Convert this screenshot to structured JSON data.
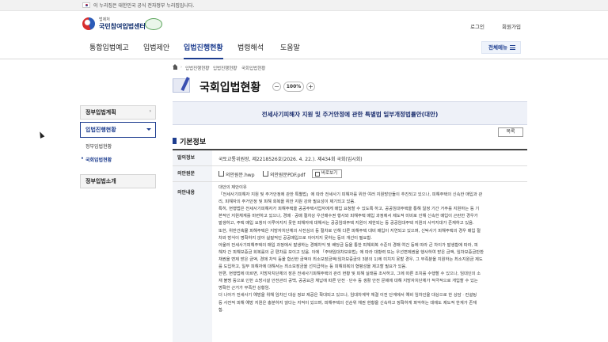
{
  "gov_banner": {
    "text": "이 누리집은 대한민국 공식 전자정부 누리집입니다."
  },
  "header": {
    "logo_small": "법제처",
    "logo_main": "국민참여입법센터",
    "util_links": [
      "로그인",
      "회원가입"
    ]
  },
  "gnb": {
    "items": [
      "통합입법예고",
      "입법제안",
      "입법진행현황",
      "법령해석",
      "도움말"
    ],
    "active": "입법진행현황",
    "all_menu": "전체메뉴"
  },
  "breadcrumb": [
    "입법진행현황",
    "입법진행현황",
    "국회입법현황"
  ],
  "page": {
    "title": "국회입법현황",
    "zoom_minus": "−",
    "zoom_value": "100%",
    "zoom_plus": "+"
  },
  "lnb": {
    "top": "정부입법계획",
    "active": "입법진행현황",
    "sub_items": [
      "정부입법현황",
      "국회입법현황"
    ],
    "selected_sub": "국회입법현황",
    "bottom": "정부입법소개"
  },
  "bill": {
    "title": "전세사기피해자 지원 및 주거안정에 관한 특별법 일부개정법률안(대안)",
    "list_button": "목록"
  },
  "basic_info": {
    "heading": "기본정보",
    "rows": {
      "proposer_label": "발의정보",
      "proposer_value": "국토교통위원장, 제2218526호(2026. 4. 22.). 제434회 국회(임시회)",
      "original_label": "의안원문",
      "files": [
        "의안원문.hwp",
        "의안원문PDF.pdf"
      ],
      "view_button": "바로보기",
      "content_label": "의안내용"
    },
    "content_lines": [
      "대안의 제안이유",
      "「전세사기피해자 지원 및 주거안정에 관한 특별법」에 따라 전세사기 피해자를 위한 여러 지원방안들이 추진되고 있으나, 피해주택의 신속한 매입과 관",
      "리, 피해자의 주거안정 및 피해 회복을 위한 지원 강화 필요성이 제기되고 있음.",
      "특히, 현행법은 전세사기피해자가 피해주택을 공공주택사업자에게 매입 요청할 수 있도록 하고, 공공임대주택을 통해 일정 기간 거주를 지원하는 등 기",
      "본적인 지원체계를 마련하고 있으나, 경매ㆍ공매 절차상 우선매수권 행사와 피해주택 매입 과정에서 제도적 미비로 인해 신속한 매입이 곤란한 경우가",
      "발생하고, 주택 매입 요청이 이루어지지 못한 피해자에 대해서는 공공임대주택 지원이 제한되는 등 공공임대주택 지원의 사각지대가 존재하고 있음.",
      "또한, 위반건축물 피해주택은 지방자치단체의 사전심의 등 절차로 인해 다른 피해주택 대비 매입이 지연되고 있으며, 신탁사기 피해주택의 경우 매입 절",
      "차와 방식이 명확하지 않아 실질적인 공공매입으로 이어지지 못하는 등의 개선이 필요함.",
      "아울러 전세사기피해주택의 매입 과정에서 발생하는 경매차익 및 배당금 등을 통한 피해회복 수준이 경매 여건 등에 따라 큰 차이가 발생함에 따라, 피",
      "해자 간 피해보증금 회복률의 큰 편차를 보이고 있음. 이에 「주택임대차보호법」에 따라 대항력 또는 우선변제권을 행사하여 받은 금액, 임차보증금반환",
      "채권을 변제 받은 금액, 경매 차익 등을 합산한 금액이 최소보장금액(임차보증금의 3분의 1)에 미치지 못할 경우, 그 부족분을 지원하는 최소지원금 제도",
      "를 도입하고, 일부 피해자에 대해서는 최소보장금을 선지급하는 등 피해회복의 형평성을 제고할 필요가 있음.",
      "한편, 현행법에 따르면, 지방자치단체의 장은 전세사기피해주택의 관리 현황 및 피해 실태를 조사하고, 그에 따른 조치를 수행할 수 있으나, 임대인의 소",
      "재 불명 등으로 인한 소방시설 안전관리 공백, 공공요금 체납에 따른 단전ㆍ단수 등 생활 안전 문제에 대해 지방자치단체가 적극적으로 개입할 수 있는",
      "명확한 근거가 부족한 상황임.",
      "더 나아가 전세사기 예방을 위해 임차인 대상 정보 제공은 확대되고 있으나, 임대차계약 체결 이전 단계에서 예비 임차인을 대상으로 한 상담ㆍ컨설팅",
      "등 사전적 피해 예방 지원은 충분하지 않다는 지적이 있으며, 피해주택의 선순위 채권 현황을 신속하고 정확하게 파악하는 데에도 제도적 한계가 존재",
      "함."
    ]
  }
}
